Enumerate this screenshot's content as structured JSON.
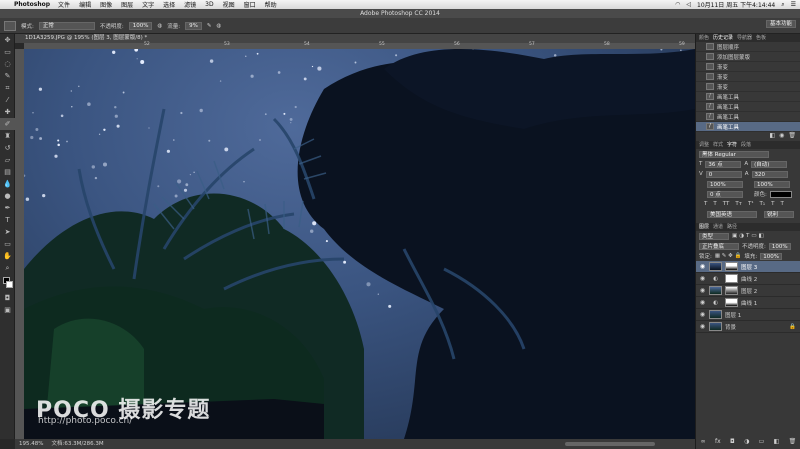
{
  "menubar": {
    "app": "Photoshop",
    "items": [
      "文件",
      "编辑",
      "图像",
      "图层",
      "文字",
      "选择",
      "滤镜",
      "3D",
      "视图",
      "窗口",
      "帮助"
    ],
    "date": "10月11日 周五 下午4:14:44"
  },
  "window": {
    "title": "Adobe Photoshop CC 2014"
  },
  "options": {
    "mode_label": "模式:",
    "mode_value": "正常",
    "opacity_label": "不透明度:",
    "opacity_value": "100%",
    "flow_label": "流量:",
    "flow_value": "9%",
    "workspace": "基本功能"
  },
  "document": {
    "tab": "1D1A3259.JPG @ 195% (图层 3, 图层蒙版/8) *",
    "zoom": "195.48%",
    "docsize": "文档:63.3M/286.3M",
    "ruler_marks": [
      "52",
      "53",
      "54",
      "55",
      "56",
      "57",
      "58",
      "59"
    ]
  },
  "history": {
    "tabs": [
      "颜色",
      "历史记录",
      "导航器",
      "色板"
    ],
    "items": [
      "图层顺序",
      "添加图层蒙版",
      "渐变",
      "渐变",
      "渐变",
      "画笔工具",
      "画笔工具",
      "画笔工具",
      "画笔工具"
    ]
  },
  "character": {
    "tabs": [
      "调整",
      "样式",
      "字符",
      "段落"
    ],
    "font": "黑体 Regular",
    "size": "36 点",
    "leading": "(自动)",
    "kerning": "0",
    "tracking": "320",
    "vscale": "100%",
    "hscale": "100%",
    "baseline": "0 点",
    "color_label": "颜色:",
    "lang": "美国英语",
    "aa": "锐利"
  },
  "layers": {
    "tabs": [
      "图层",
      "通道",
      "路径"
    ],
    "kind": "类型",
    "blend": "正片叠底",
    "opacity_label": "不透明度:",
    "opacity": "100%",
    "fill_label": "填充:",
    "fill": "100%",
    "lock_label": "锁定:",
    "items": [
      {
        "name": "图层 3",
        "selected": true,
        "mask": true
      },
      {
        "name": "曲线 2",
        "selected": false,
        "mask": true
      },
      {
        "name": "图层 2",
        "selected": false,
        "mask": false
      },
      {
        "name": "曲线 1",
        "selected": false,
        "mask": true
      },
      {
        "name": "图层 1",
        "selected": false,
        "mask": false
      },
      {
        "name": "背景",
        "selected": false,
        "mask": false
      }
    ]
  },
  "watermark": {
    "logo": "POCO 摄影专题",
    "url": "http://photo.poco.cn/"
  }
}
